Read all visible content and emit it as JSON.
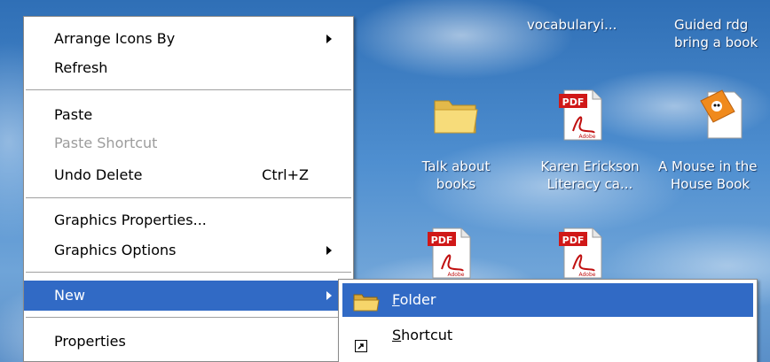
{
  "desktop": {
    "icons": [
      {
        "label_line1": "vocabularyi...",
        "label_line2": "",
        "icon": "shortcut-doc-icon"
      },
      {
        "label_line1": "Guided rdg",
        "label_line2": "bring a book",
        "icon": "doc-icon"
      },
      {
        "label_line1": "Talk about",
        "label_line2": "books",
        "icon": "folder-icon"
      },
      {
        "label_line1": "Karen Erickson",
        "label_line2": "Literacy ca...",
        "icon": "pdf-icon"
      },
      {
        "label_line1": "A Mouse in the",
        "label_line2": "House Book",
        "icon": "document-image-icon"
      },
      {
        "label_line1": "",
        "label_line2": "",
        "icon": "pdf-icon"
      },
      {
        "label_line1": "",
        "label_line2": "",
        "icon": "pdf-icon"
      }
    ],
    "pdf_badge": "PDF",
    "pdf_brand": "Adobe"
  },
  "context_menu": {
    "items": [
      {
        "label": "Arrange Icons By",
        "submenu": true
      },
      {
        "label": "Refresh"
      },
      {
        "label": "Paste"
      },
      {
        "label": "Paste Shortcut",
        "disabled": true
      },
      {
        "label": "Undo Delete",
        "shortcut": "Ctrl+Z"
      },
      {
        "label": "Graphics Properties..."
      },
      {
        "label": "Graphics Options",
        "submenu": true
      },
      {
        "label": "New",
        "submenu": true,
        "highlighted": true
      },
      {
        "label": "Properties"
      }
    ]
  },
  "new_submenu": {
    "items": [
      {
        "label_mnemonic": "F",
        "label_rest": "older",
        "icon": "folder-icon",
        "highlighted": true
      },
      {
        "label_mnemonic": "S",
        "label_rest": "hortcut",
        "icon": "shortcut-icon"
      }
    ]
  },
  "colors": {
    "highlight": "#316ac5",
    "disabled_text": "#9c9c9c",
    "menu_bg": "#ffffff"
  }
}
